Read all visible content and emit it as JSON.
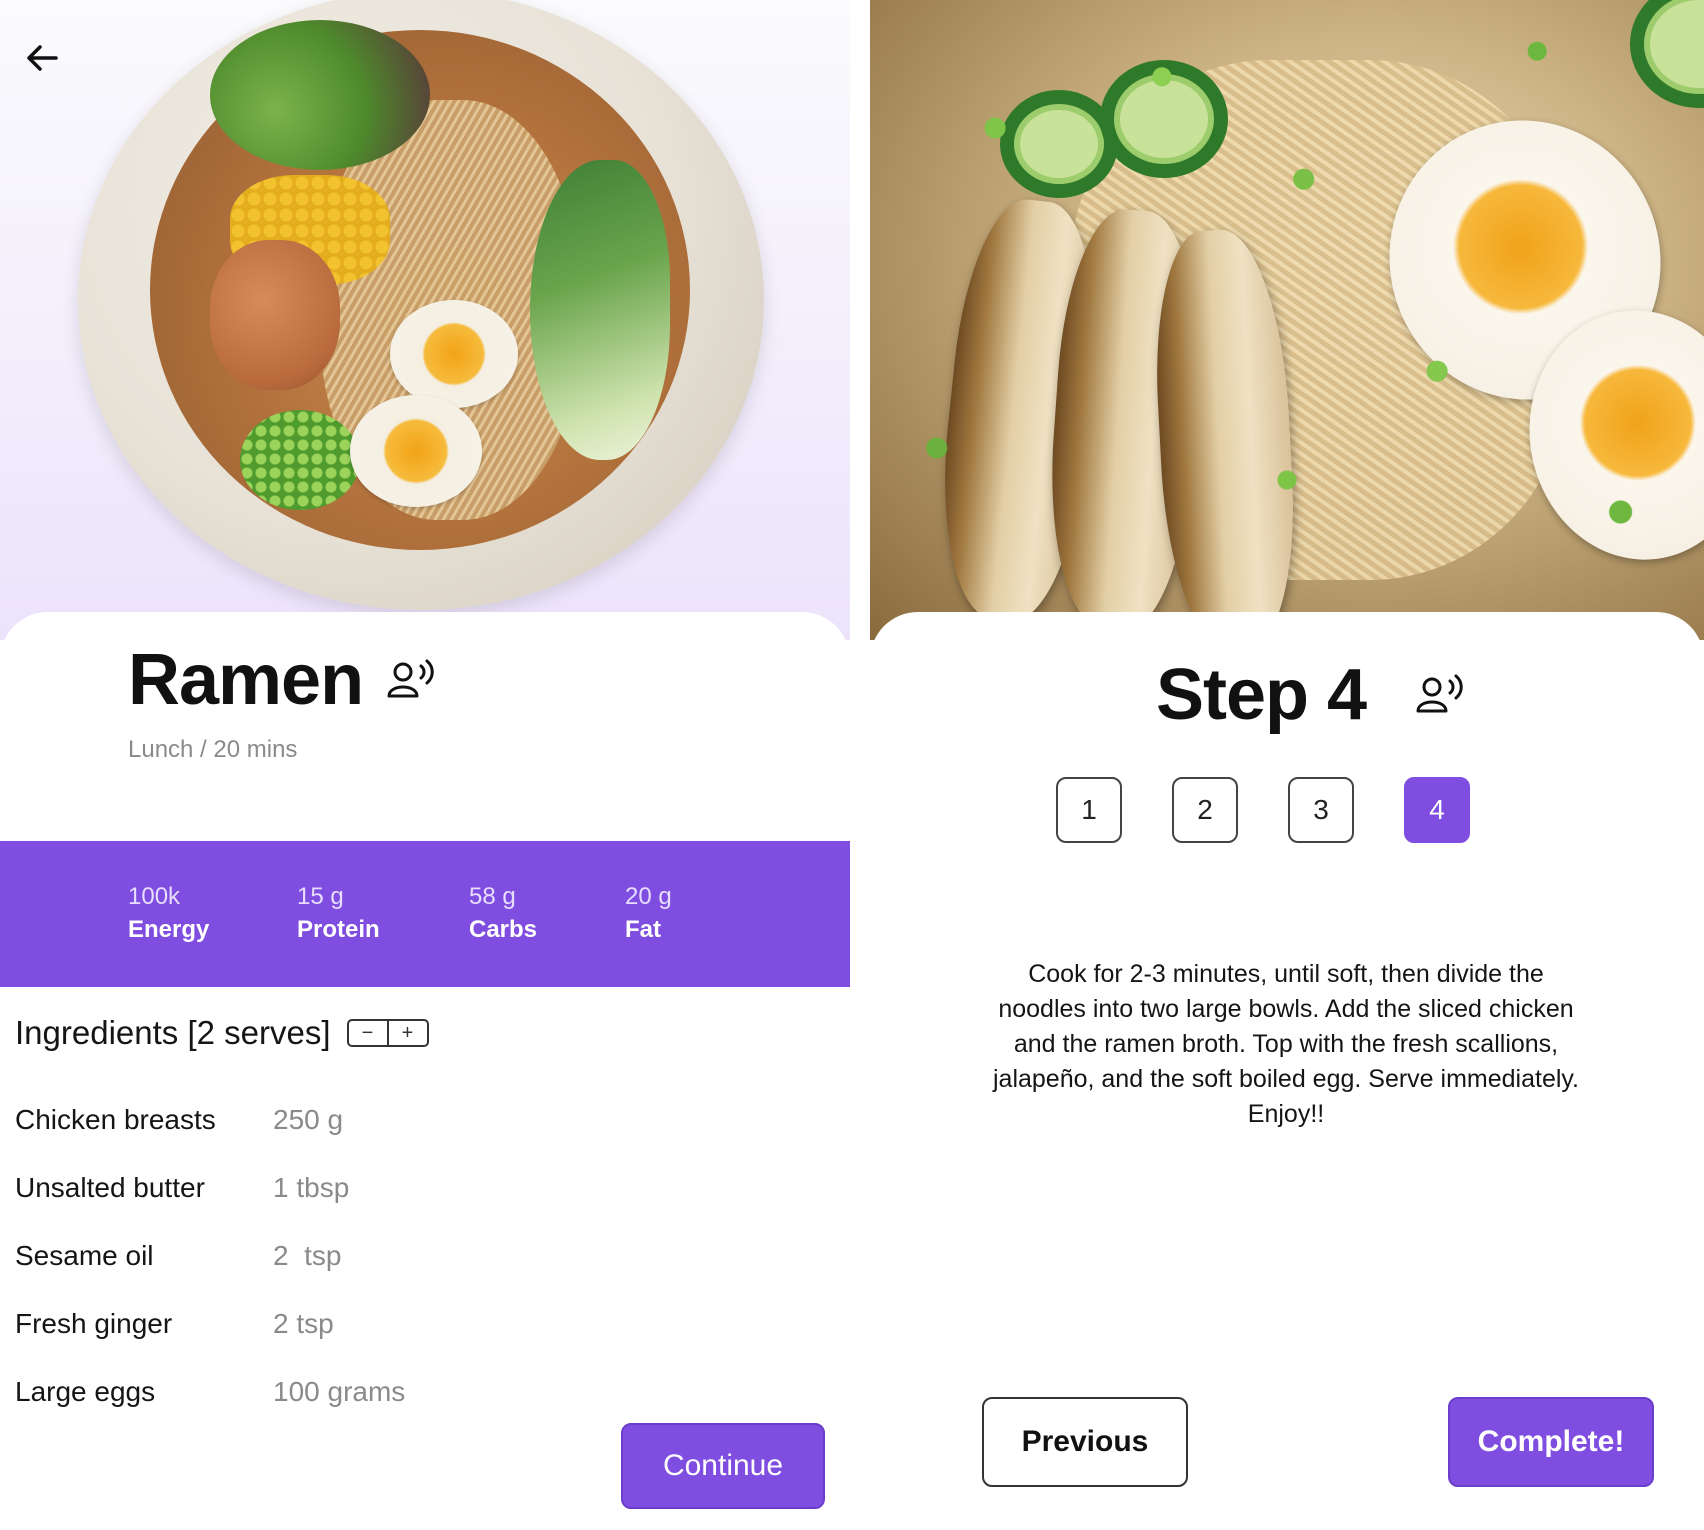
{
  "colors": {
    "accent": "#7f4ee0",
    "muted_text": "#8a8a8a",
    "hero_gradient_end": "#ece3fb"
  },
  "recipe_screen": {
    "back_icon": "arrow-left-icon",
    "hero_image": "ramen-bowl-photo",
    "title": "Ramen",
    "voice_icon": "voice-assistant-icon",
    "subtitle": "Lunch / 20 mins",
    "nutrition": [
      {
        "value": "100k",
        "label": "Energy"
      },
      {
        "value": "15 g",
        "label": "Protein"
      },
      {
        "value": "58 g",
        "label": "Carbs"
      },
      {
        "value": "20 g",
        "label": "Fat"
      }
    ],
    "ingredients_title": "Ingredients [2 serves]",
    "serves_stepper": {
      "decrement": "−",
      "increment": "+"
    },
    "ingredients": [
      {
        "name": "Chicken breasts",
        "qty": "250 g"
      },
      {
        "name": "Unsalted butter",
        "qty": "1 tbsp"
      },
      {
        "name": "Sesame oil",
        "qty": "2  tsp"
      },
      {
        "name": "Fresh ginger",
        "qty": "2 tsp"
      },
      {
        "name": "Large eggs",
        "qty": "100 grams"
      }
    ],
    "continue_label": "Continue"
  },
  "step_screen": {
    "hero_image": "ramen-closeup-photo",
    "title": "Step 4",
    "voice_icon": "voice-assistant-icon",
    "steps": [
      "1",
      "2",
      "3",
      "4"
    ],
    "active_step": 4,
    "instructions": "Cook for 2-3 minutes, until soft, then divide the noodles into two large bowls. Add the sliced chicken and the ramen broth. Top with the fresh scallions, jalapeño, and the soft boiled egg. Serve immediately. Enjoy!!",
    "previous_label": "Previous",
    "complete_label": "Complete!"
  }
}
